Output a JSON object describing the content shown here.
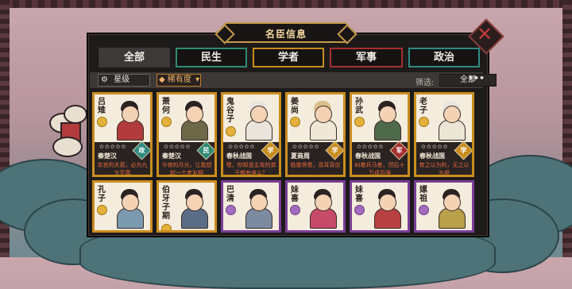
{
  "window": {
    "title": "名臣信息"
  },
  "tabs": [
    {
      "label": "全部",
      "color": "#3c3938"
    },
    {
      "label": "民生",
      "color": "#2f8a73"
    },
    {
      "label": "学者",
      "color": "#c98d1f"
    },
    {
      "label": "军事",
      "color": "#a4302f"
    },
    {
      "label": "政治",
      "color": "#2f8a82"
    }
  ],
  "filters": {
    "rarity_label": "星级",
    "sort_label": "稀有度",
    "filter_label": "筛选:",
    "filter_value": "全部"
  },
  "cards": [
    {
      "name": "吕雉",
      "origin": "秦楚汉",
      "category": "政",
      "cat_color": "#2f8a82",
      "quote": "本宫的夫君，必为九五至尊",
      "rarity": "gold",
      "robe": "#b23c3c",
      "stars": "✿✿✿✿✿"
    },
    {
      "name": "萧何",
      "origin": "秦楚汉",
      "category": "民",
      "cat_color": "#2f8a73",
      "quote": "今夜的月光，让我想起一个老友啊",
      "rarity": "gold",
      "robe": "#6d6848",
      "stars": "✿✿✿✿✿"
    },
    {
      "name": "鬼谷子",
      "origin": "春秋战国",
      "category": "学",
      "cat_color": "#c98d1f",
      "quote": "嘿，你知道主攻的弟子都有谁么？",
      "rarity": "gold",
      "robe": "#e9e4dc",
      "stars": "✿✿✿✿✿"
    },
    {
      "name": "姜尚",
      "origin": "夏商周",
      "category": "学",
      "cat_color": "#c98d1f",
      "quote": "临崖将卷，双耳背伏",
      "rarity": "gold",
      "robe": "#efe8d6",
      "stars": "✿✿✿✿✿"
    },
    {
      "name": "孙武",
      "origin": "春秋战国",
      "category": "军",
      "cat_color": "#a4302f",
      "quote": "纠着兵马者，然后十万成百强",
      "rarity": "gold",
      "robe": "#4f6a4a",
      "stars": "✿✿✿✿✿"
    },
    {
      "name": "老子",
      "origin": "春秋战国",
      "category": "学",
      "cat_color": "#c98d1f",
      "quote": "育之以为利，无之以为用",
      "rarity": "gold",
      "robe": "#ece6d7",
      "stars": "✿✿✿✿✿"
    },
    {
      "name": "孔子",
      "origin": "",
      "category": "",
      "cat_color": "#c98d1f",
      "quote": "",
      "rarity": "gold",
      "robe": "#7a9ab0",
      "stars": ""
    },
    {
      "name": "伯牙子期",
      "origin": "",
      "category": "",
      "cat_color": "#c98d1f",
      "quote": "",
      "rarity": "gold",
      "robe": "#5b6d86",
      "stars": ""
    },
    {
      "name": "巴清",
      "origin": "",
      "category": "",
      "cat_color": "#7a3e96",
      "quote": "",
      "rarity": "purple",
      "robe": "#7c8aa0",
      "stars": ""
    },
    {
      "name": "妹喜",
      "origin": "",
      "category": "",
      "cat_color": "#7a3e96",
      "quote": "",
      "rarity": "purple",
      "robe": "#c64b6a",
      "stars": ""
    },
    {
      "name": "妹喜",
      "origin": "",
      "category": "",
      "cat_color": "#7a3e96",
      "quote": "",
      "rarity": "purple",
      "robe": "#b94040",
      "stars": ""
    },
    {
      "name": "嫘祖",
      "origin": "",
      "category": "",
      "cat_color": "#7a3e96",
      "quote": "",
      "rarity": "purple",
      "robe": "#b9a04a",
      "stars": ""
    }
  ]
}
